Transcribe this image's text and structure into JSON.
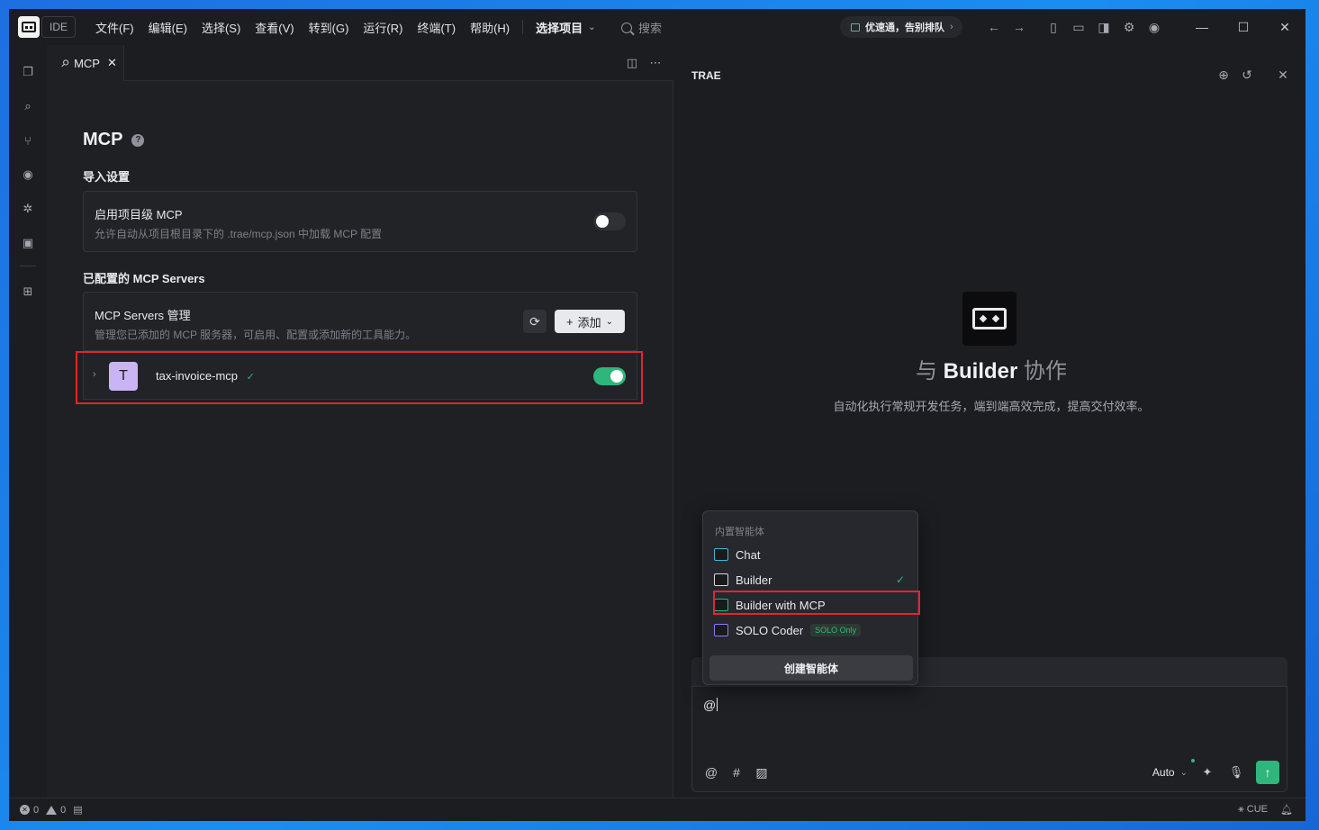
{
  "titlebar": {
    "ide_badge": "IDE",
    "menu": [
      "文件(F)",
      "编辑(E)",
      "选择(S)",
      "查看(V)",
      "转到(G)",
      "运行(R)",
      "终端(T)",
      "帮助(H)"
    ],
    "project": "选择项目",
    "search_placeholder": "搜索",
    "promo": "优速通，告别排队"
  },
  "tab": {
    "label": "MCP"
  },
  "mcp": {
    "title": "MCP",
    "import_section": "导入设置",
    "project_mcp": {
      "title": "启用项目级 MCP",
      "desc": "允许自动从项目根目录下的 .trae/mcp.json 中加载 MCP 配置",
      "enabled": false
    },
    "configured_section": "已配置的 MCP Servers",
    "servers_card": {
      "title": "MCP Servers 管理",
      "desc": "管理您已添加的 MCP 服务器，可启用、配置或添加新的工具能力。",
      "add_label": "添加"
    },
    "servers": [
      {
        "avatar": "T",
        "name": "tax-invoice-mcp",
        "status": "ok",
        "enabled": true
      }
    ]
  },
  "chat": {
    "title": "TRAE",
    "collab_prefix": "与",
    "collab_agent": "Builder",
    "collab_suffix": "协作",
    "subtitle": "自动化执行常规开发任务，端到端高效完成，提高交付效率。",
    "input_value": "@",
    "model": "Auto"
  },
  "agent_menu": {
    "header": "内置智能体",
    "items": [
      {
        "label": "Chat",
        "color": "#3fb7d8",
        "selected": false
      },
      {
        "label": "Builder",
        "color": "#d6d8de",
        "selected": true
      },
      {
        "label": "Builder with MCP",
        "color": "#2fb67c",
        "selected": false
      },
      {
        "label": "SOLO Coder",
        "color": "#8a7cf0",
        "selected": false,
        "badge": "SOLO Only"
      }
    ],
    "create_label": "创建智能体"
  },
  "statusbar": {
    "errors": "0",
    "warnings": "0",
    "cue": "CUE"
  }
}
